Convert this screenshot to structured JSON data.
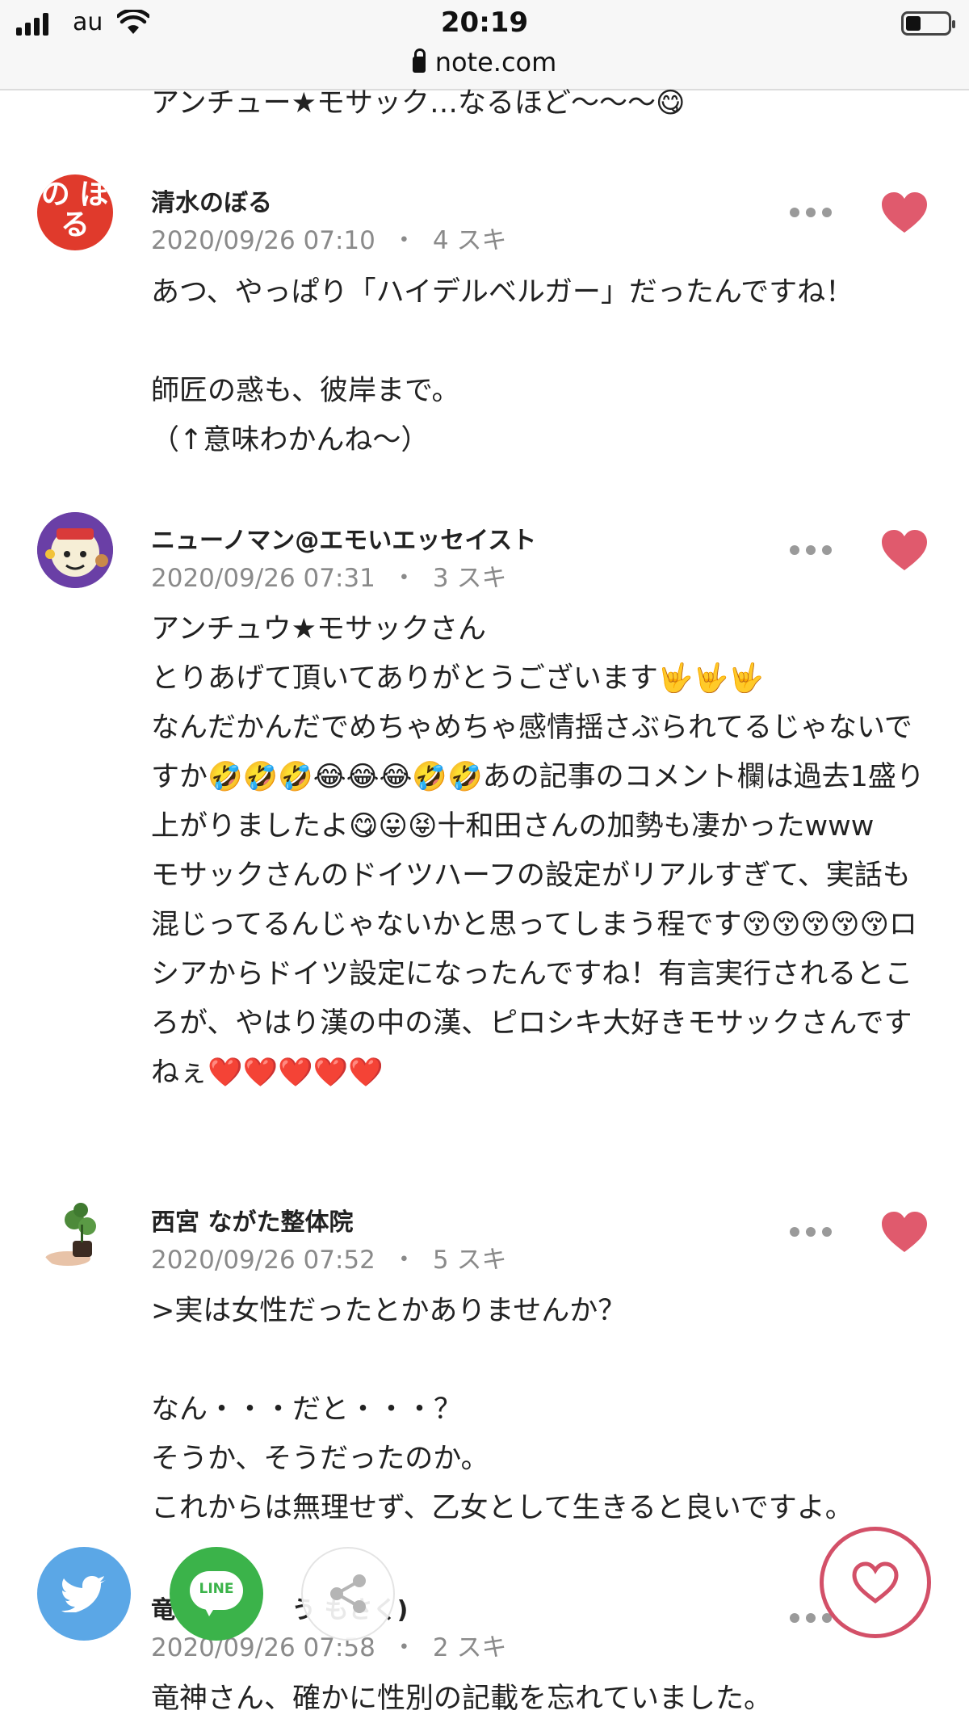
{
  "status_bar": {
    "carrier": "au",
    "time": "20:19",
    "url": "note.com",
    "battery_level": 0.35
  },
  "colors": {
    "heart": "#e05a6d",
    "twitter": "#5ba7e6",
    "line": "#3bb34a",
    "meta_text": "#8a8a8a"
  },
  "top_fragment": "アンチュー★モサック…なるほど〜〜〜😋",
  "comments": [
    {
      "user": "清水のぼる",
      "date": "2020/09/26 07:10",
      "separator": "・",
      "likes": "4 スキ",
      "avatar_text": "の ぼる",
      "text": "あつ、やっぱり「ハイデルベルガー」だったんですね！\n\n師匠の惑も、彼岸まで。\n（↑意味わかんね〜）"
    },
    {
      "user": "ニューノマン@エモいエッセイスト",
      "date": "2020/09/26 07:31",
      "separator": "・",
      "likes": "3 スキ",
      "text": "アンチュウ★モサックさん\nとりあげて頂いてありがとうございます🤟🤟🤟\nなんだかんだでめちゃめちゃ感情揺さぶられてるじゃないですか🤣🤣🤣😂😂😂🤣🤣あの記事のコメント欄は過去1盛り上がりましたよ😋😛😝十和田さんの加勢も凄かったwww\nモサックさんのドイツハーフの設定がリアルすぎて、実話も混じってるんじゃないかと思ってしまう程です😚😚😚😚😚ロシアからドイツ設定になったんですね！有言実行されるところが、やはり漢の中の漢、ピロシキ大好きモサックさんですねぇ❤️❤️❤️❤️❤️"
    },
    {
      "user": "西宮 ながた整体院",
      "date": "2020/09/26 07:52",
      "separator": "・",
      "likes": "5 スキ",
      "text": ">実は女性だったとかありませんか？\n\nなん・・・だと・・・？\nそうか、そうだったのか。\nこれからは無理せず、乙女として生きると良いですよ。"
    },
    {
      "user": "竜神 (あ　　う もさく)",
      "date": "2020/09/26 07:58",
      "separator": "・",
      "likes": "2 スキ",
      "text": "竜神さん、確かに性別の記載を忘れていました。"
    }
  ],
  "fab": {
    "twitter_icon": "twitter-bird-icon",
    "line_label": "LINE",
    "share_icon": "share-icon",
    "like_icon": "heart-outline-icon"
  }
}
